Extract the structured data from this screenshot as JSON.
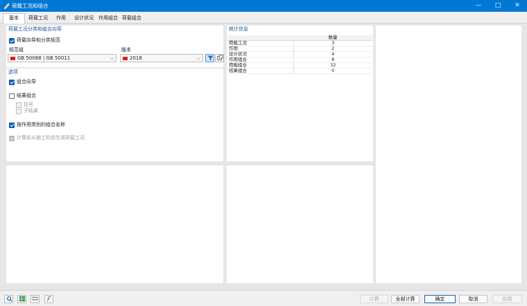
{
  "window": {
    "title": "荷载工况和组合",
    "min": "—",
    "max": "□",
    "close": "✕"
  },
  "tabs": [
    "基本",
    "荷载工况",
    "作用",
    "设计状况",
    "作用组合",
    "荷载组合"
  ],
  "wizard": {
    "header": "荷载工况分类和组合向导",
    "use_wizard_label": "荷载向导和分类规范",
    "standard_group_label": "规范组",
    "standard_group_value": "GB 50068 | GB 50011",
    "edition_label": "版本",
    "edition_value": "2018"
  },
  "options": {
    "header": "选项",
    "combination_wizard": "组合向导",
    "result_combination": "结果组合",
    "brackets": "括号",
    "sub_results": "子结果",
    "action_type_names": "按作用类别的组合名称",
    "generate_from_stages": "计算前从施工阶段生成荷载工况"
  },
  "stats": {
    "header": "统计信息",
    "column_count": "数量",
    "rows": [
      {
        "label": "荷载工况",
        "value": "3"
      },
      {
        "label": "作用",
        "value": "2"
      },
      {
        "label": "设计状况",
        "value": "4"
      },
      {
        "label": "作用组合",
        "value": "8"
      },
      {
        "label": "荷载组合",
        "value": "32"
      },
      {
        "label": "结果组合",
        "value": "0"
      }
    ]
  },
  "buttons": {
    "calculate": "计算",
    "calculate_all": "全部计算",
    "ok": "确定",
    "cancel": "取消",
    "apply": "应用"
  },
  "colors": {
    "titlebar": "#0078d4",
    "accent": "#0f5fb5",
    "flag": "#d62020"
  },
  "icons": [
    "search-icon",
    "table-icon",
    "list-icon",
    "formula-icon",
    "filter-icon",
    "settings-icon"
  ]
}
